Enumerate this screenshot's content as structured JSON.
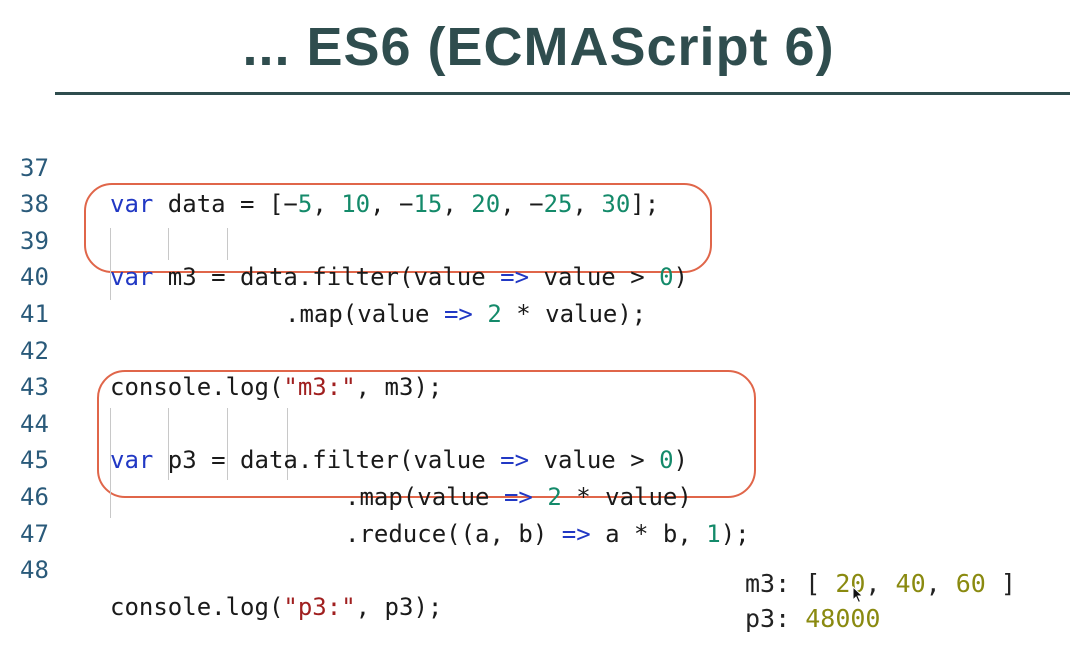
{
  "slide": {
    "title": "... ES6 (ECMAScript 6)"
  },
  "code": {
    "lines": [
      {
        "number": "37",
        "text": "var data = [−5, 10, −15, 20, −25, 30];"
      },
      {
        "number": "38",
        "text": ""
      },
      {
        "number": "39",
        "text": "var m3 = data.filter(value => value > 0)"
      },
      {
        "number": "40",
        "text": ".map(value => 2 * value);"
      },
      {
        "number": "41",
        "text": ""
      },
      {
        "number": "42",
        "text": "console.log(\"m3:\", m3);"
      },
      {
        "number": "43",
        "text": ""
      },
      {
        "number": "44",
        "text": "var p3 = data.filter(value => value > 0)"
      },
      {
        "number": "45",
        "text": ".map(value => 2 * value)"
      },
      {
        "number": "46",
        "text": ".reduce((a, b) => a * b, 1);"
      },
      {
        "number": "47",
        "text": ""
      },
      {
        "number": "48",
        "text": "console.log(\"p3:\", p3);"
      }
    ]
  },
  "output": {
    "m3_label": "m3:",
    "m3_values": [
      "20",
      "40",
      "60"
    ],
    "p3_label": "p3:",
    "p3_value": "48000"
  },
  "colors": {
    "keyword": "#2138c4",
    "number": "#148a6a",
    "string": "#a01f1f",
    "highlight_border": "#e0664a",
    "title": "#2f4d4e"
  }
}
